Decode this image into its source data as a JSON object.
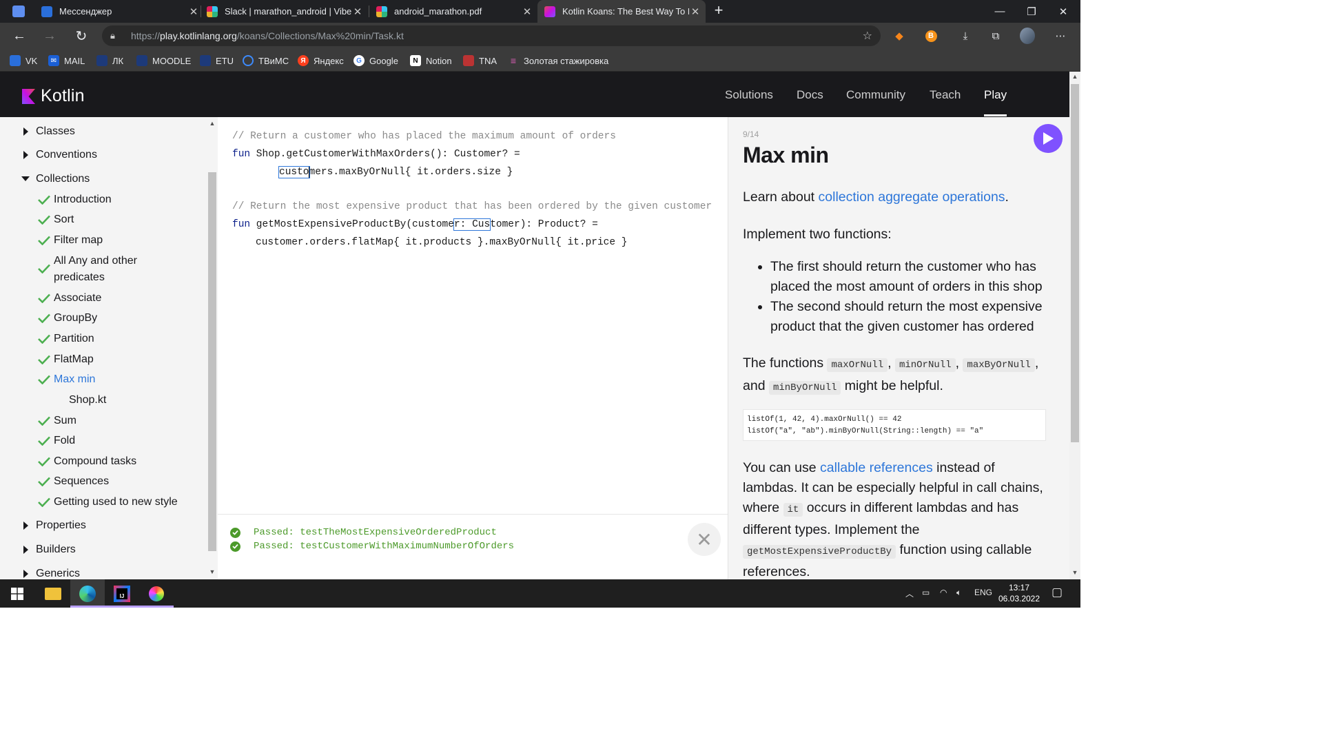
{
  "browser": {
    "tabs": [
      {
        "label": "Мессенджер",
        "color": "#2a6fdb"
      },
      {
        "label": "Slack | marathon_android | Vibel",
        "color": "#e01e5a"
      },
      {
        "label": "android_marathon.pdf",
        "color": "#e01e5a"
      },
      {
        "label": "Kotlin Koans: The Best Way To Le",
        "color": "#7f52ff"
      }
    ],
    "url_prefix": "https://",
    "url_host": "play.kotlinlang.org",
    "url_path": "/koans/Collections/Max%20min/Task.kt",
    "bookmarks": [
      "VK",
      "MAIL",
      "ЛК",
      "MOODLE",
      "ETU",
      "ТВиМС",
      "Яндекс",
      "Google",
      "Notion",
      "TNA",
      "Золотая стажировка"
    ]
  },
  "header": {
    "brand": "Kotlin",
    "nav": [
      "Solutions",
      "Docs",
      "Community",
      "Teach",
      "Play"
    ],
    "active_nav": "Play"
  },
  "sidebar": {
    "sections": [
      {
        "label": "Classes",
        "expanded": false
      },
      {
        "label": "Conventions",
        "expanded": false
      },
      {
        "label": "Collections",
        "expanded": true
      },
      {
        "label": "Properties",
        "expanded": false
      },
      {
        "label": "Builders",
        "expanded": false
      },
      {
        "label": "Generics",
        "expanded": false
      }
    ],
    "items": [
      "Introduction",
      "Sort",
      "Filter map",
      "All Any and other predicates",
      "Associate",
      "GroupBy",
      "Partition",
      "FlatMap",
      "Max min",
      "Sum",
      "Fold",
      "Compound tasks",
      "Sequences",
      "Getting used to new style"
    ],
    "active_item": "Max min",
    "sub_file": "Shop.kt"
  },
  "editor": {
    "comment1": "// Return a customer who has placed the maximum amount of orders",
    "line1_kw": "fun",
    "line1_rest": " Shop.getCustomerWithMaxOrders(): Customer? =",
    "line2_hl": "custo",
    "line2_a": "m",
    "line2_rest": "ers.maxByOrNull{ it.orders.size }",
    "comment2": "// Return the most expensive product that has been ordered by the given customer",
    "line3_kw": "fun",
    "line3_a": " getMostExpensiveProductBy(custome",
    "line3_hl": "r: Cus",
    "line3_rest": "tomer): Product? =",
    "line4": "customer.orders.flatMap{ it.products }.maxByOrNull{ it.price }"
  },
  "console": {
    "results": [
      "Passed: testTheMostExpensiveOrderedProduct",
      "Passed: testCustomerWithMaximumNumberOfOrders"
    ]
  },
  "task": {
    "counter": "9/14",
    "title": "Max min",
    "learn_prefix": "Learn about ",
    "learn_link": "collection aggregate operations",
    "learn_suffix": ".",
    "implement": "Implement two functions:",
    "bullets": [
      "The first should return the customer who has placed the most amount of orders in this shop",
      "The second should return the most expensive product that the given customer has ordered"
    ],
    "functions_prefix": "The functions ",
    "fn1": "maxOrNull",
    "fn2": "minOrNull",
    "fn3": "maxByOrNull",
    "fn4": "minByOrNull",
    "and_text": ", and ",
    "helpful": " might be helpful.",
    "code_line1": "listOf(1, 42, 4).maxOrNull() == 42",
    "code_line2": "listOf(\"a\", \"ab\").minByOrNull(String::length) == \"a\"",
    "callable_prefix": "You can use ",
    "callable_link": "callable references",
    "callable_mid": " instead of lambdas. It can be especially helpful in call chains, where ",
    "it_code": "it",
    "callable_mid2": " occurs in different lambdas and has different types. Implement the ",
    "fn_code": "getMostExpensiveProductBy",
    "callable_end": " function using callable references."
  },
  "taskbar": {
    "lang": "ENG",
    "time": "13:17",
    "date": "06.03.2022"
  }
}
